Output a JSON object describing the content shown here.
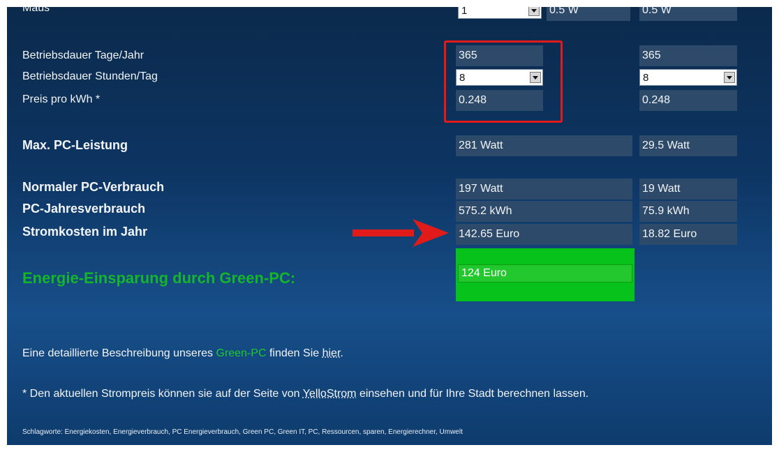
{
  "mouse": {
    "label": "Maus",
    "select_value": "1",
    "left_value": "0.5 W",
    "right_value": "0.5 W"
  },
  "days": {
    "label": "Betriebsdauer Tage/Jahr",
    "left_value": "365",
    "right_value": "365"
  },
  "hours": {
    "label": "Betriebsdauer Stunden/Tag",
    "left_value": "8",
    "right_value": "8"
  },
  "price": {
    "label": "Preis pro kWh *",
    "left_value": "0.248",
    "right_value": "0.248"
  },
  "max_power": {
    "label": "Max. PC-Leistung",
    "left_value": "281 Watt",
    "right_value": "29.5 Watt"
  },
  "normal": {
    "label": "Normaler PC-Verbrauch",
    "left_value": "197 Watt",
    "right_value": "19 Watt"
  },
  "annual": {
    "label": "PC-Jahresverbrauch",
    "left_value": "575.2 kWh",
    "right_value": "75.9 kWh"
  },
  "cost": {
    "label": "Stromkosten im Jahr",
    "left_value": "142.65 Euro",
    "right_value": "18.82 Euro"
  },
  "saving": {
    "label": "Energie-Einsparung durch Green-PC:",
    "value": "124 Euro"
  },
  "description": {
    "before": "Eine detaillierte Beschreibung unseres ",
    "brand": "Green-PC",
    "middle": " finden Sie ",
    "link": "hier",
    "after": "."
  },
  "note": {
    "before": "* Den aktuellen Strompreis können sie auf der Seite von ",
    "link": "YelloStrom",
    "after": " einsehen und für Ihre Stadt berechnen lassen."
  },
  "tags": "Schlagworte: Energiekosten, Energieverbrauch, PC Energieverbrauch, Green PC, Green IT, PC, Ressourcen, sparen, Energierechner, Umwelt",
  "colors": {
    "highlight": "#e11a1a",
    "saving_green": "#08c21c",
    "panel_blue": "#0d3563"
  }
}
